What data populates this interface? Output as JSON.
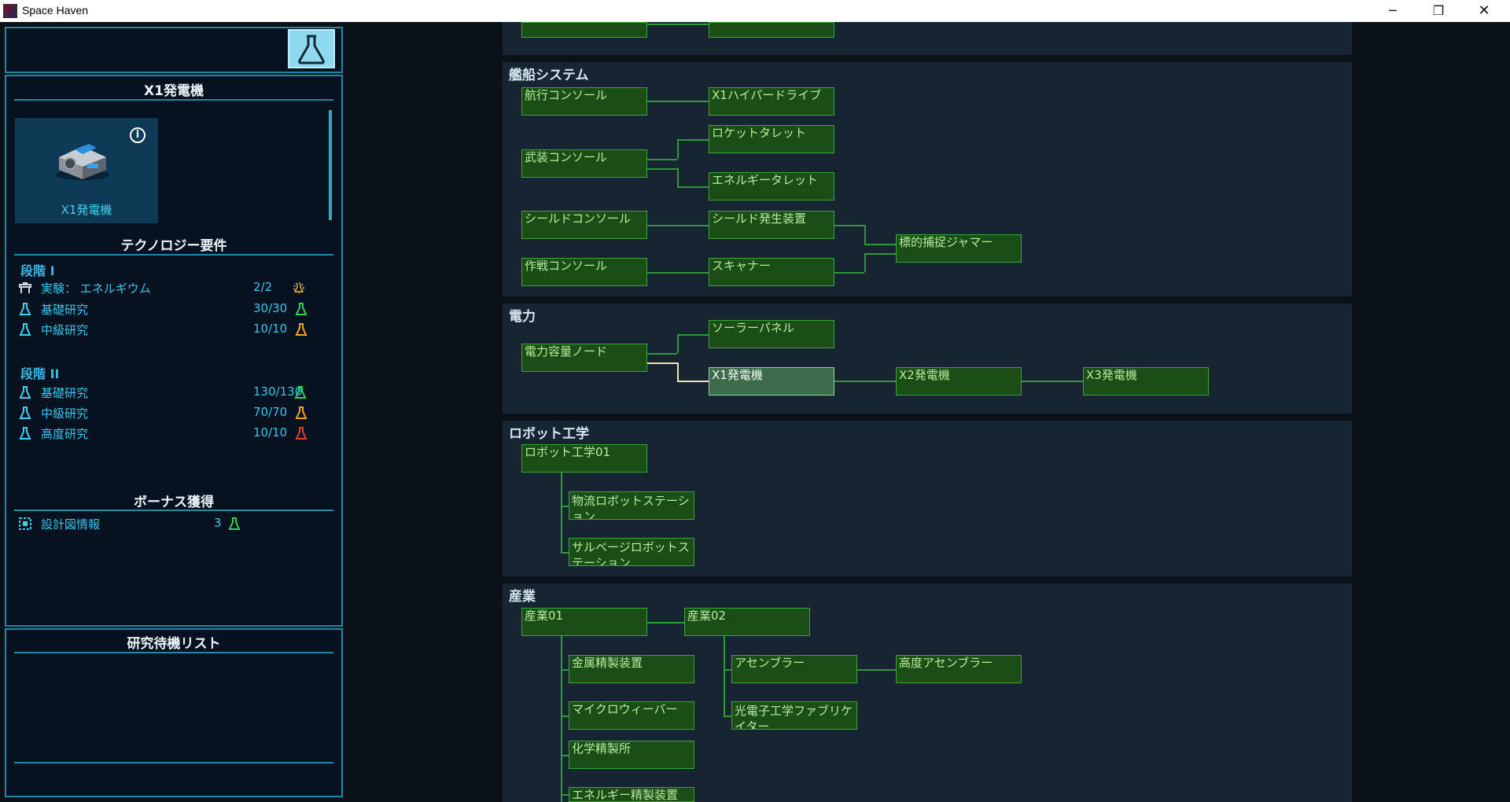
{
  "window": {
    "title": "Space Haven",
    "minimize": "─",
    "maximize": "❐",
    "close": "✕"
  },
  "detail": {
    "title": "X1発電機",
    "item_name": "X1発電機",
    "info": "i",
    "tech_header": "テクノロジー要件",
    "stage1": {
      "label": "段階 I",
      "rows": [
        {
          "label": "実験： エネルギウム",
          "value": "2/2"
        },
        {
          "label": "基礎研究",
          "value": "30/30"
        },
        {
          "label": "中級研究",
          "value": "10/10"
        }
      ]
    },
    "stage2": {
      "label": "段階 II",
      "rows": [
        {
          "label": "基礎研究",
          "value": "130/130"
        },
        {
          "label": "中級研究",
          "value": "70/70"
        },
        {
          "label": "高度研究",
          "value": "10/10"
        }
      ]
    },
    "bonus_header": "ボーナス獲得",
    "bonus": {
      "label": "設計図情報",
      "value": "3"
    }
  },
  "queue": {
    "title": "研究待機リスト"
  },
  "colors": {
    "basic": "#2fd15a",
    "intermediate": "#f0a326",
    "advanced": "#e63a2a",
    "accent": "#1e8aa6"
  },
  "sections": {
    "ship": {
      "title": "艦船システム",
      "nodes": {
        "nav_console": "航行コンソール",
        "x1_hyperdrive": "X1ハイパードライブ",
        "weapons_console": "武装コンソール",
        "rocket_turret": "ロケットタレット",
        "energy_turret": "エネルギータレット",
        "shield_console": "シールドコンソール",
        "shield_generator": "シールド発生装置",
        "targeting_jammer": "標的捕捉ジャマー",
        "ops_console": "作戦コンソール",
        "scanner": "スキャナー"
      }
    },
    "power": {
      "title": "電力",
      "nodes": {
        "power_node": "電力容量ノード",
        "solar_panel": "ソーラーパネル",
        "x1_generator": "X1発電機",
        "x2_generator": "X2発電機",
        "x3_generator": "X3発電機"
      }
    },
    "robotics": {
      "title": "ロボット工学",
      "nodes": {
        "robotics01": "ロボット工学01",
        "logistics_station": "物流ロボットステーション",
        "salvage_station": "サルベージロボットステーション"
      }
    },
    "industry": {
      "title": "産業",
      "nodes": {
        "industry01": "産業01",
        "industry02": "産業02",
        "metal_refinery": "金属精製装置",
        "assembler": "アセンブラー",
        "advanced_assembler": "高度アセンブラー",
        "microweaver": "マイクロウィーバー",
        "optronics_fabricator": "光電子工学ファブリケイター",
        "chemical_refinery": "化学精製所",
        "energy_refinery": "エネルギー精製装置"
      }
    }
  }
}
